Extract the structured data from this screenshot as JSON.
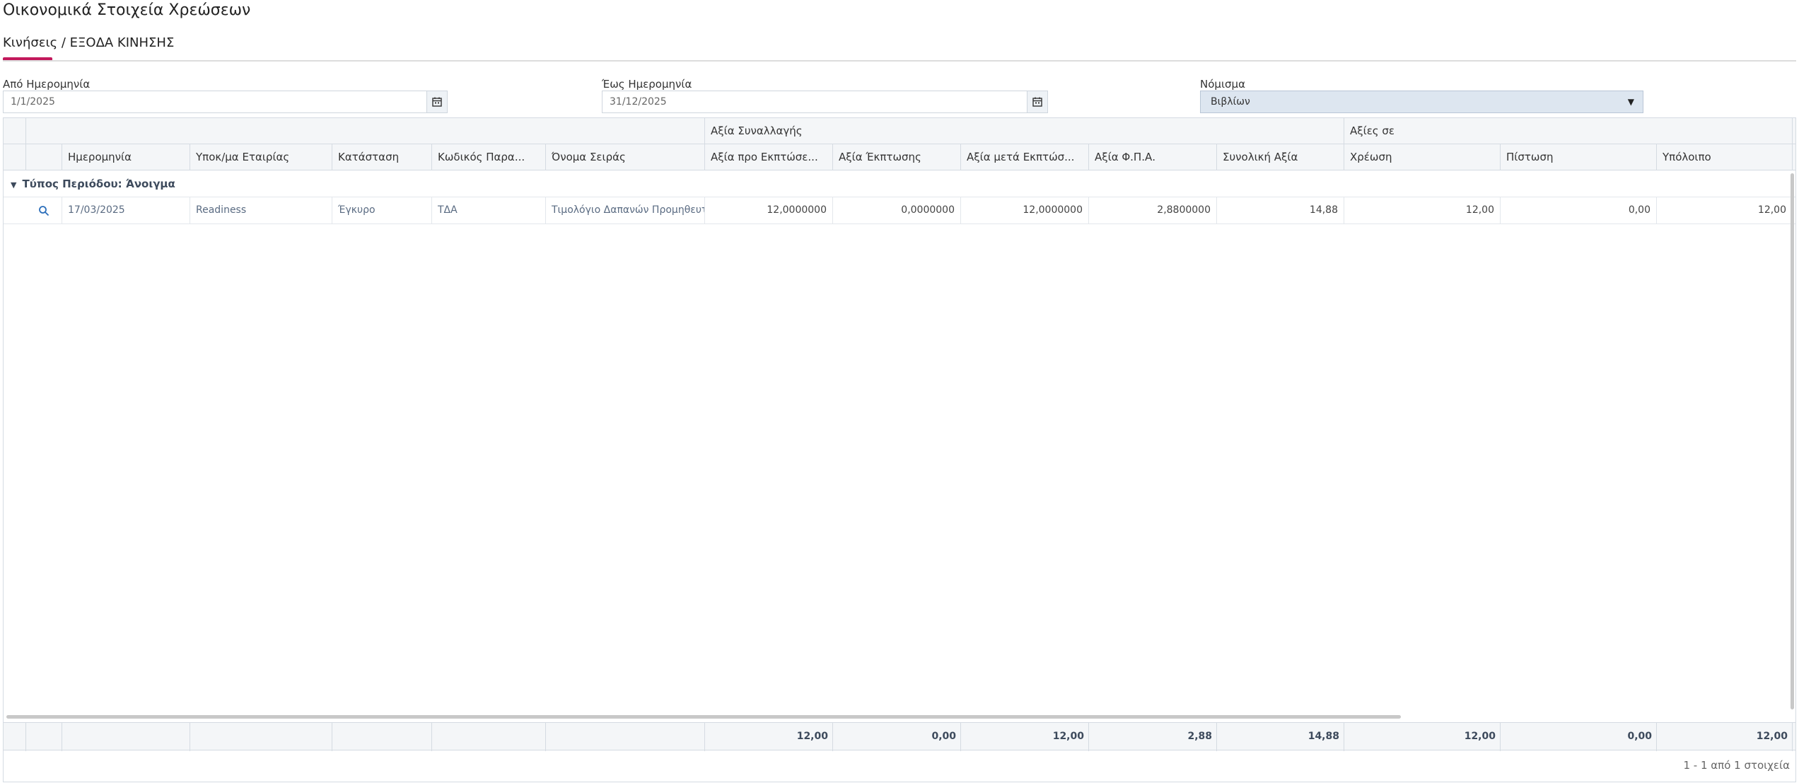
{
  "page": {
    "title": "Οικονομικά Στοιχεία Χρεώσεων"
  },
  "tabs": [
    {
      "label": "Κινήσεις / ΕΞΟΔΑ ΚΙΝΗΣΗΣ",
      "active": true
    }
  ],
  "colors": {
    "accent": "#c2185b",
    "header_bg": "#f4f6f8",
    "select_bg": "#dde6f0"
  },
  "filters": {
    "from_date": {
      "label": "Από Ημερομηνία",
      "value": "1/1/2025"
    },
    "to_date": {
      "label": "Έως Ημερομηνία",
      "value": "31/12/2025"
    },
    "currency": {
      "label": "Νόμισμα",
      "value": "Βιβλίων"
    }
  },
  "grid": {
    "groups": {
      "transaction_value": "Αξία Συναλλαγής",
      "values_in": "Αξίες σε"
    },
    "columns": [
      "Ημερομηνία",
      "Υποκ/μα Εταιρίας",
      "Κατάσταση",
      "Κωδικός Παρα...",
      "Όνομα Σειράς",
      "Αξία προ Εκπτώσε...",
      "Αξία Έκπτωσης",
      "Αξία μετά Εκπτώσ...",
      "Αξία Φ.Π.Α.",
      "Συνολική Αξία",
      "Χρέωση",
      "Πίστωση",
      "Υπόλοιπο"
    ],
    "group_row": {
      "label": "Τύπος Περιόδου: Άνοιγμα"
    },
    "rows": [
      {
        "date": "17/03/2025",
        "branch": "Readiness",
        "status": "Έγκυρο",
        "doc_code": "ΤΔΑ",
        "series_name": "Τιμολόγιο Δαπανών Προμηθευτή",
        "value_before_discount": "12,0000000",
        "discount_value": "0,0000000",
        "value_after_discount": "12,0000000",
        "vat_value": "2,8800000",
        "total_value": "14,88",
        "debit": "12,00",
        "credit": "0,00",
        "balance": "12,00"
      }
    ],
    "totals": {
      "value_before_discount": "12,00",
      "discount_value": "0,00",
      "value_after_discount": "12,00",
      "vat_value": "2,88",
      "total_value": "14,88",
      "debit": "12,00",
      "credit": "0,00",
      "balance": "12,00"
    },
    "pager": "1 - 1 από 1 στοιχεία"
  }
}
